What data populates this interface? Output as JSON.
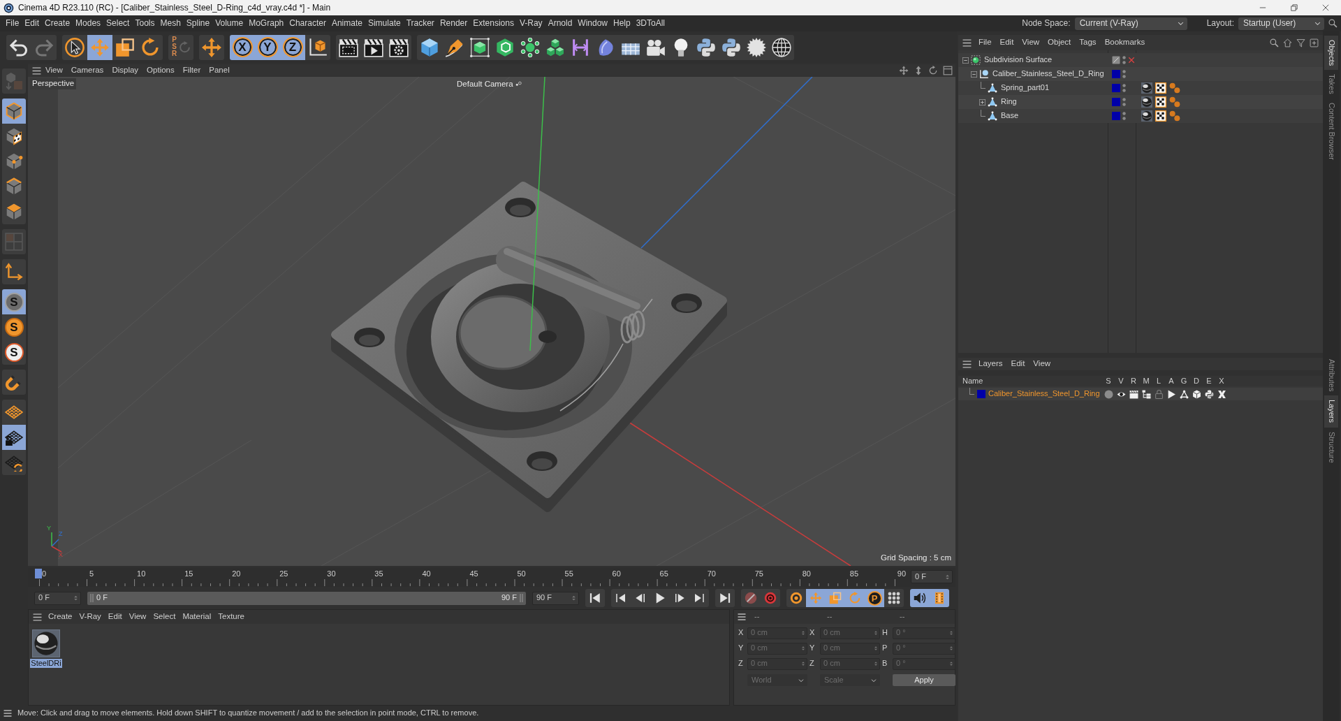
{
  "window": {
    "title": "Cinema 4D R23.110 (RC) - [Caliber_Stainless_Steel_D-Ring_c4d_vray.c4d *] - Main"
  },
  "menu": [
    "File",
    "Edit",
    "Create",
    "Modes",
    "Select",
    "Tools",
    "Mesh",
    "Spline",
    "Volume",
    "MoGraph",
    "Character",
    "Animate",
    "Simulate",
    "Tracker",
    "Render",
    "Extensions",
    "V-Ray",
    "Arnold",
    "Window",
    "Help",
    "3DToAll"
  ],
  "node_space": {
    "label": "Node Space:",
    "value": "Current (V-Ray)"
  },
  "layout": {
    "label": "Layout:",
    "value": "Startup (User)"
  },
  "toolbar_groups": [
    {
      "buttons": [
        {
          "kind": "undo",
          "selected": false,
          "disabled": false
        },
        {
          "kind": "redo",
          "selected": false,
          "disabled": true
        }
      ]
    },
    {
      "buttons": [
        {
          "kind": "select",
          "selected": false,
          "disabled": false
        },
        {
          "kind": "move",
          "selected": true,
          "disabled": false
        },
        {
          "kind": "scale",
          "selected": false,
          "disabled": false
        },
        {
          "kind": "rotate",
          "selected": false,
          "disabled": false
        }
      ]
    },
    {
      "buttons": [
        {
          "kind": "psr",
          "label": "PSR",
          "selected": false,
          "disabled": true
        }
      ]
    },
    {
      "buttons": [
        {
          "kind": "transform",
          "selected": false,
          "disabled": false
        }
      ]
    },
    {
      "buttons": [
        {
          "kind": "axis-lock",
          "label": "X",
          "selected": true,
          "disabled": false
        },
        {
          "kind": "axis-lock",
          "label": "Y",
          "selected": true,
          "disabled": false
        },
        {
          "kind": "axis-lock",
          "label": "Z",
          "selected": true,
          "disabled": false
        },
        {
          "kind": "coords",
          "selected": false,
          "disabled": false
        }
      ]
    },
    {
      "buttons": [
        {
          "kind": "render-region",
          "selected": false,
          "disabled": false
        },
        {
          "kind": "render-view",
          "selected": false,
          "disabled": false
        },
        {
          "kind": "render-settings",
          "selected": false,
          "disabled": false
        }
      ]
    },
    {
      "buttons": [
        {
          "kind": "cube",
          "selected": false,
          "disabled": false
        },
        {
          "kind": "pen",
          "selected": false,
          "disabled": false
        },
        {
          "kind": "subdivision",
          "selected": false,
          "disabled": false
        },
        {
          "kind": "extrude",
          "selected": false,
          "disabled": false
        },
        {
          "kind": "cloner",
          "selected": false,
          "disabled": false
        },
        {
          "kind": "array",
          "selected": false,
          "disabled": false
        },
        {
          "kind": "bracket",
          "selected": false,
          "disabled": false
        },
        {
          "kind": "deformer",
          "selected": false,
          "disabled": false
        },
        {
          "kind": "floor",
          "selected": false,
          "disabled": false
        },
        {
          "kind": "camera",
          "selected": false,
          "disabled": false
        },
        {
          "kind": "light",
          "selected": false,
          "disabled": false
        },
        {
          "kind": "python",
          "selected": false,
          "disabled": false
        },
        {
          "kind": "python",
          "selected": false,
          "disabled": false
        },
        {
          "kind": "seal",
          "selected": false,
          "disabled": false
        },
        {
          "kind": "globe",
          "selected": false,
          "disabled": false
        }
      ]
    }
  ],
  "mode_toolbar_groups": [
    {
      "buttons": [
        {
          "kind": "model",
          "selected": false,
          "disabled": true
        }
      ]
    },
    {
      "buttons": [
        {
          "kind": "object",
          "selected": true,
          "disabled": false
        },
        {
          "kind": "texture",
          "selected": false,
          "disabled": false
        },
        {
          "kind": "points",
          "selected": false,
          "disabled": false
        },
        {
          "kind": "edges",
          "selected": false,
          "disabled": false
        },
        {
          "kind": "polygons",
          "selected": false,
          "disabled": false
        }
      ]
    },
    {
      "buttons": [
        {
          "kind": "uv",
          "selected": false,
          "disabled": true
        }
      ]
    },
    {
      "buttons": [
        {
          "kind": "axes",
          "selected": false,
          "disabled": false
        }
      ]
    },
    {
      "buttons": [
        {
          "kind": "snap",
          "label": "S",
          "selected": true,
          "disabled": false
        },
        {
          "kind": "snap-orange",
          "label": "S",
          "selected": false,
          "disabled": false
        },
        {
          "kind": "snap-white",
          "label": "S",
          "selected": false,
          "disabled": false
        }
      ]
    },
    {
      "buttons": [
        {
          "kind": "magnet",
          "selected": false,
          "disabled": false
        }
      ]
    },
    {
      "buttons": [
        {
          "kind": "workplane",
          "selected": false,
          "disabled": false
        },
        {
          "kind": "gridlock",
          "selected": true,
          "disabled": false
        },
        {
          "kind": "gridsync",
          "selected": false,
          "disabled": false
        }
      ]
    }
  ],
  "viewport": {
    "menu": [
      "View",
      "Cameras",
      "Display",
      "Options",
      "Filter",
      "Panel"
    ],
    "view_name": "Perspective",
    "camera": "Default Camera",
    "grid_spacing": "Grid Spacing : 5 cm",
    "axis_labels": [
      "Y",
      "Z",
      "X"
    ]
  },
  "timeline": {
    "ticks": [
      "0",
      "5",
      "10",
      "15",
      "20",
      "25",
      "30",
      "35",
      "40",
      "45",
      "50",
      "55",
      "60",
      "65",
      "70",
      "75",
      "80",
      "85",
      "90"
    ],
    "level": 0,
    "current_frame": "0 F",
    "start_field": "0 F",
    "range": {
      "start": "0 F",
      "end": "90 F",
      "level": 1
    },
    "end_field": "90 F",
    "button_groups": [
      {
        "buttons": [
          {
            "kind": "first",
            "selected": false
          }
        ]
      },
      {
        "buttons": [
          {
            "kind": "prev-key",
            "selected": false
          },
          {
            "kind": "prev-frame",
            "selected": false
          },
          {
            "kind": "play",
            "selected": false
          },
          {
            "kind": "next-frame",
            "selected": false
          },
          {
            "kind": "next-key",
            "selected": false
          }
        ]
      },
      {
        "buttons": [
          {
            "kind": "last",
            "selected": false
          }
        ]
      },
      {
        "buttons": [
          {
            "kind": "record",
            "selected": false
          },
          {
            "kind": "autokey",
            "selected": false
          }
        ]
      },
      {
        "buttons": [
          {
            "kind": "keyframe",
            "selected": false
          },
          {
            "kind": "key-move",
            "selected": true
          },
          {
            "kind": "key-scale",
            "selected": true
          },
          {
            "kind": "key-rotate",
            "selected": true
          },
          {
            "kind": "key-param",
            "label": "P",
            "selected": true
          },
          {
            "kind": "key-pla",
            "selected": false
          }
        ]
      },
      {
        "buttons": [
          {
            "kind": "sound",
            "selected": true
          },
          {
            "kind": "film",
            "selected": true
          }
        ]
      }
    ]
  },
  "material_manager": {
    "menu": [
      "Create",
      "V-Ray",
      "Edit",
      "View",
      "Select",
      "Material",
      "Texture"
    ],
    "materials": [
      {
        "name": "SteelDRi",
        "selected": true
      }
    ]
  },
  "coordinates": {
    "disabled": true,
    "headers": [
      "--",
      "--",
      "--"
    ],
    "rows": [
      {
        "cells": [
          {
            "axis": "X",
            "value": "0 cm"
          },
          {
            "axis": "X",
            "value": "0 cm"
          },
          {
            "axis": "H",
            "value": "0 °"
          }
        ]
      },
      {
        "cells": [
          {
            "axis": "Y",
            "value": "0 cm"
          },
          {
            "axis": "Y",
            "value": "0 cm"
          },
          {
            "axis": "P",
            "value": "0 °"
          }
        ]
      },
      {
        "cells": [
          {
            "axis": "Z",
            "value": "0 cm"
          },
          {
            "axis": "Z",
            "value": "0 cm"
          },
          {
            "axis": "B",
            "value": "0 °"
          }
        ]
      }
    ],
    "dropdowns": [
      "World",
      "Scale"
    ],
    "apply": "Apply"
  },
  "status_bar": {
    "text": "Move: Click and drag to move elements. Hold down SHIFT to quantize movement / add to the selection in point mode, CTRL to remove."
  },
  "object_manager": {
    "menu": [
      "File",
      "Edit",
      "View",
      "Object",
      "Tags",
      "Bookmarks"
    ],
    "objects": [
      {
        "name": "Subdivision Surface",
        "kind": "subdivision",
        "expanded": true,
        "enabled": false,
        "children": [
          {
            "name": "Caliber_Stainless_Steel_D_Ring",
            "kind": "null",
            "expanded": true,
            "color": "#0000a8",
            "children": [
              {
                "name": "Spring_part01",
                "kind": "polygon",
                "color": "#0000a8",
                "tags": [
                  {
                    "kind": "material"
                  },
                  {
                    "kind": "uvw"
                  },
                  {
                    "kind": "vray"
                  }
                ]
              },
              {
                "name": "Ring",
                "kind": "polygon",
                "expanded": false,
                "color": "#0000a8",
                "tags": [
                  {
                    "kind": "material"
                  },
                  {
                    "kind": "uvw"
                  },
                  {
                    "kind": "vray"
                  }
                ]
              },
              {
                "name": "Base",
                "kind": "polygon",
                "color": "#0000a8",
                "tags": [
                  {
                    "kind": "material"
                  },
                  {
                    "kind": "uvw"
                  },
                  {
                    "kind": "vray"
                  }
                ]
              }
            ]
          }
        ]
      }
    ],
    "side_tabs": [
      {
        "label": "Objects",
        "selected": true
      },
      {
        "label": "Takes",
        "selected": false
      },
      {
        "label": "Content Browser",
        "selected": false
      }
    ]
  },
  "layer_manager": {
    "menu": [
      "Layers",
      "Edit",
      "View"
    ],
    "columns": [
      "Name",
      "S",
      "V",
      "R",
      "M",
      "L",
      "A",
      "G",
      "D",
      "E",
      "X"
    ],
    "layers": [
      {
        "name": "Caliber_Stainless_Steel_D_Ring",
        "color": "#0000a8",
        "solo": false,
        "visible": true,
        "render": true,
        "locked": false
      }
    ],
    "side_tabs": [
      {
        "label": "Attributes",
        "selected": false
      },
      {
        "label": "Layers",
        "selected": true
      },
      {
        "label": "Structure",
        "selected": false
      }
    ]
  }
}
